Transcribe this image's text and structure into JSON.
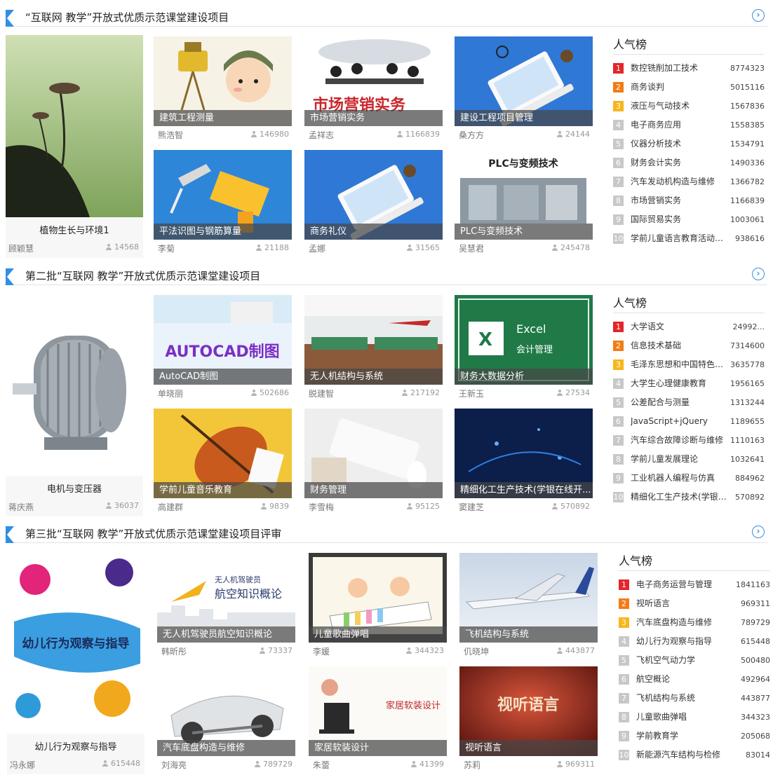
{
  "more_label": "›",
  "sections": [
    {
      "title": "“互联网 教学”开放式优质示范课堂建设项目",
      "feature": {
        "title": "植物生长与环境1",
        "author": "顾颖慧",
        "count": "14568"
      },
      "cards": [
        {
          "title": "建筑工程测量",
          "author": "熊浩智",
          "count": "146980"
        },
        {
          "title": "市场营销实务",
          "author": "孟祥志",
          "count": "1166839",
          "art_text": "市场营销实务"
        },
        {
          "title": "建设工程项目管理",
          "author": "桑方方",
          "count": "24144"
        },
        {
          "title": "平法识图与钢筋算量",
          "author": "李菊",
          "count": "21188"
        },
        {
          "title": "商务礼仪",
          "author": "孟娜",
          "count": "31565"
        },
        {
          "title": "PLC与变频技术",
          "author": "吴慧君",
          "count": "245478",
          "art_text": "PLC与变频技术"
        }
      ],
      "rank": {
        "title": "人气榜",
        "items": [
          {
            "num": "1",
            "name": "数控铣削加工技术",
            "value": "8774323"
          },
          {
            "num": "2",
            "name": "商务谈判",
            "value": "5015116"
          },
          {
            "num": "3",
            "name": "液压与气动技术",
            "value": "1567836"
          },
          {
            "num": "4",
            "name": "电子商务应用",
            "value": "1558385"
          },
          {
            "num": "5",
            "name": "仪器分析技术",
            "value": "1534791"
          },
          {
            "num": "6",
            "name": "财务会计实务",
            "value": "1490336"
          },
          {
            "num": "7",
            "name": "汽车发动机构造与维修",
            "value": "1366782"
          },
          {
            "num": "8",
            "name": "市场营销实务",
            "value": "1166839"
          },
          {
            "num": "9",
            "name": "国际贸易实务",
            "value": "1003061"
          },
          {
            "num": "10",
            "name": "学前儿童语言教育活动设...",
            "value": "938616"
          }
        ]
      }
    },
    {
      "title": "第二批“互联网 教学”开放式优质示范课堂建设项目",
      "feature": {
        "title": "电机与变压器",
        "author": "蒋庆燕",
        "count": "36037"
      },
      "cards": [
        {
          "title": "AutoCAD制图",
          "author": "单晓丽",
          "count": "502686",
          "art_text": "AUTOCAD制图"
        },
        {
          "title": "无人机结构与系统",
          "author": "脱建智",
          "count": "217192"
        },
        {
          "title": "财务大数据分析",
          "author": "王新玉",
          "count": "27534",
          "art_text": "Excel",
          "art_sub": "会计管理"
        },
        {
          "title": "学前儿童音乐教育",
          "author": "高建群",
          "count": "9839"
        },
        {
          "title": "财务管理",
          "author": "李雪梅",
          "count": "95125"
        },
        {
          "title": "精细化工生产技术(学银在线开...",
          "author": "窦建芝",
          "count": "570892"
        }
      ],
      "rank": {
        "title": "人气榜",
        "items": [
          {
            "num": "1",
            "name": "大学语文",
            "value": "24992..."
          },
          {
            "num": "2",
            "name": "信息技术基础",
            "value": "7314600"
          },
          {
            "num": "3",
            "name": "毛泽东思想和中国特色社...",
            "value": "3635778"
          },
          {
            "num": "4",
            "name": "大学生心理健康教育",
            "value": "1956165"
          },
          {
            "num": "5",
            "name": "公差配合与测量",
            "value": "1313244"
          },
          {
            "num": "6",
            "name": "JavaScript+jQuery",
            "value": "1189655"
          },
          {
            "num": "7",
            "name": "汽车综合故障诊断与维修",
            "value": "1110163"
          },
          {
            "num": "8",
            "name": "学前儿童发展理论",
            "value": "1032641"
          },
          {
            "num": "9",
            "name": "工业机器人编程与仿真",
            "value": "884962"
          },
          {
            "num": "10",
            "name": "精细化工生产技术(学银在...",
            "value": "570892"
          }
        ]
      }
    },
    {
      "title": "第三批“互联网 教学”开放式优质示范课堂建设项目评审",
      "feature": {
        "title": "幼儿行为观察与指导",
        "author": "冯永娜",
        "count": "615448",
        "art_text": "幼儿行为观察与指导"
      },
      "cards": [
        {
          "title": "无人机驾驶员航空知识概论",
          "author": "韩昕彤",
          "count": "73337",
          "art_text": "航空知识概论",
          "art_sub": "无人机驾驶员"
        },
        {
          "title": "儿童歌曲弹唱",
          "author": "李媛",
          "count": "344323"
        },
        {
          "title": "飞机结构与系统",
          "author": "仉晓坤",
          "count": "443877"
        },
        {
          "title": "汽车底盘构造与维修",
          "author": "刘海亮",
          "count": "789729"
        },
        {
          "title": "家居软装设计",
          "author": "朱蕾",
          "count": "41399",
          "art_text": "家居软装设计"
        },
        {
          "title": "视听语言",
          "author": "苏莉",
          "count": "969311",
          "art_text": "视听语言"
        }
      ],
      "rank": {
        "title": "人气榜",
        "items": [
          {
            "num": "1",
            "name": "电子商务运营与管理",
            "value": "1841163"
          },
          {
            "num": "2",
            "name": "视听语言",
            "value": "969311"
          },
          {
            "num": "3",
            "name": "汽车底盘构造与维修",
            "value": "789729"
          },
          {
            "num": "4",
            "name": "幼儿行为观察与指导",
            "value": "615448"
          },
          {
            "num": "5",
            "name": "飞机空气动力学",
            "value": "500480"
          },
          {
            "num": "6",
            "name": "航空概论",
            "value": "492964"
          },
          {
            "num": "7",
            "name": "飞机结构与系统",
            "value": "443877"
          },
          {
            "num": "8",
            "name": "儿童歌曲弹唱",
            "value": "344323"
          },
          {
            "num": "9",
            "name": "学前教育学",
            "value": "205068"
          },
          {
            "num": "10",
            "name": "新能源汽车结构与检修",
            "value": "83014"
          }
        ]
      }
    }
  ]
}
